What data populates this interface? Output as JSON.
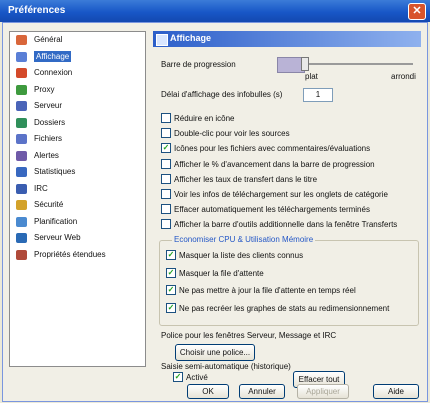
{
  "window": {
    "title": "Préférences",
    "close_glyph": "✕"
  },
  "sidebar": {
    "items": [
      {
        "label": "Général",
        "icon": "general-icon",
        "color": "#d9663a"
      },
      {
        "label": "Affichage",
        "icon": "display-icon",
        "color": "#5a7fd6",
        "selected": true
      },
      {
        "label": "Connexion",
        "icon": "connection-icon",
        "color": "#d44a2a"
      },
      {
        "label": "Proxy",
        "icon": "proxy-icon",
        "color": "#3e9a3e"
      },
      {
        "label": "Serveur",
        "icon": "server-icon",
        "color": "#4a64b8"
      },
      {
        "label": "Dossiers",
        "icon": "folders-icon",
        "color": "#2f8f5a"
      },
      {
        "label": "Fichiers",
        "icon": "files-icon",
        "color": "#5b73c8"
      },
      {
        "label": "Alertes",
        "icon": "alerts-icon",
        "color": "#6f5aa8"
      },
      {
        "label": "Statistiques",
        "icon": "statistics-icon",
        "color": "#3868c0"
      },
      {
        "label": "IRC",
        "icon": "irc-icon",
        "color": "#3a5db0"
      },
      {
        "label": "Sécurité",
        "icon": "security-icon",
        "color": "#d3a22a"
      },
      {
        "label": "Planification",
        "icon": "schedule-icon",
        "color": "#4a8ad0"
      },
      {
        "label": "Serveur Web",
        "icon": "webserver-icon",
        "color": "#2a6ab5"
      },
      {
        "label": "Propriétés étendues",
        "icon": "extended-props-icon",
        "color": "#b04a3a"
      }
    ]
  },
  "panel": {
    "title": "Affichage",
    "progress_bar_label": "Barre de progression",
    "slider_min_label": "plat",
    "slider_max_label": "arrondi",
    "tooltip_delay_label": "Délai d'affichage des infobulles (s)",
    "tooltip_delay_value": "1",
    "options": [
      {
        "label": "Réduire en icône",
        "checked": false
      },
      {
        "label": "Double-clic pour voir les sources",
        "checked": false
      },
      {
        "label": "Icônes pour les fichiers avec commentaires/évaluations",
        "checked": true
      },
      {
        "label": "Afficher le % d'avancement dans la barre de progression",
        "checked": false
      },
      {
        "label": "Afficher les taux de transfert dans le titre",
        "checked": false
      },
      {
        "label": "Voir les infos de téléchargement sur les onglets de catégorie",
        "checked": false
      },
      {
        "label": "Effacer automatiquement les téléchargements terminés",
        "checked": false
      },
      {
        "label": "Afficher la barre d'outils additionnelle dans la fenêtre Transferts",
        "checked": false
      }
    ],
    "group_title": "Economiser CPU & Utilisation Mémoire",
    "group_options": [
      {
        "label": "Masquer la liste des clients connus",
        "checked": true
      },
      {
        "label": "Masquer la file d'attente",
        "checked": true
      },
      {
        "label": "Ne pas mettre à jour la file d'attente en temps réel",
        "checked": true
      },
      {
        "label": "Ne pas recréer les graphes de stats au redimensionnement",
        "checked": true
      }
    ],
    "font_label": "Police pour les fenêtres Serveur, Message et IRC",
    "font_button": "Choisir une police...",
    "history_label": "Saisie semi-automatique (historique)",
    "history_active_label": "Activé",
    "history_active_checked": true,
    "clear_button": "Effacer tout"
  },
  "footer": {
    "ok": "OK",
    "cancel": "Annuler",
    "apply": "Appliquer",
    "help": "Aide"
  }
}
